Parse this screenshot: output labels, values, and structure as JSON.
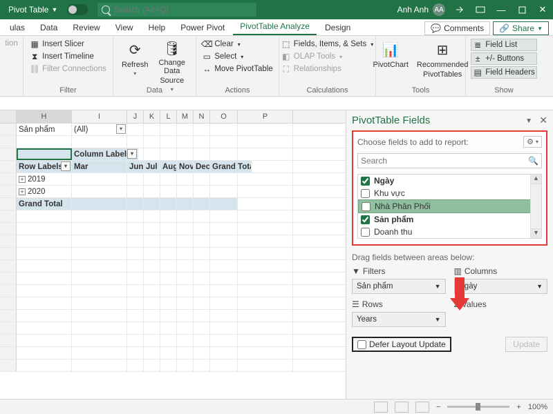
{
  "title": {
    "doc": "Pivot Table",
    "user": "Anh Anh",
    "avatar": "AA",
    "search_placeholder": "Search (Alt+Q)"
  },
  "tabs": {
    "items": [
      "ulas",
      "Data",
      "Review",
      "View",
      "Help",
      "Power Pivot",
      "PivotTable Analyze",
      "Design"
    ],
    "active_index": 6,
    "comments": "Comments",
    "share": "Share"
  },
  "ribbon": {
    "g0": {
      "item": "tion"
    },
    "filter": {
      "label": "Filter",
      "slicer": "Insert Slicer",
      "timeline": "Insert Timeline",
      "connections": "Filter Connections"
    },
    "data": {
      "label": "Data",
      "refresh": "Refresh",
      "change": "Change Data",
      "source": "Source"
    },
    "actions": {
      "label": "Actions",
      "clear": "Clear",
      "select": "Select",
      "move": "Move PivotTable"
    },
    "calc": {
      "label": "Calculations",
      "fields": "Fields, Items, & Sets",
      "olap": "OLAP Tools",
      "rel": "Relationships"
    },
    "tools": {
      "label": "Tools",
      "chart": "PivotChart",
      "rec": "Recommended",
      "rec2": "PivotTables"
    },
    "show": {
      "label": "Show",
      "fieldlist": "Field List",
      "buttons": "+/- Buttons",
      "headers": "Field Headers"
    }
  },
  "grid": {
    "cols": [
      {
        "l": "H",
        "w": 80
      },
      {
        "l": "I",
        "w": 80
      },
      {
        "l": "J",
        "w": 24
      },
      {
        "l": "K",
        "w": 24
      },
      {
        "l": "L",
        "w": 24
      },
      {
        "l": "M",
        "w": 24
      },
      {
        "l": "N",
        "w": 24
      },
      {
        "l": "O",
        "w": 40
      },
      {
        "l": "P",
        "w": 80
      }
    ],
    "rows": {
      "filter_label": "Sản phẩm",
      "filter_val": "(All)",
      "collabels": "Column Labels",
      "rowlabels": "Row Labels",
      "mar": "Mar",
      "jun": "Jun",
      "jul": "Jul",
      "aug": "Aug",
      "nov": "Nov",
      "dec": "Dec",
      "gt": "Grand Total",
      "y1": "2019",
      "y2": "2020",
      "gtrow": "Grand Total"
    }
  },
  "pane": {
    "title": "PivotTable Fields",
    "choose": "Choose fields to add to report:",
    "search_ph": "Search",
    "fields": [
      {
        "label": "Ngày",
        "checked": true,
        "bold": true
      },
      {
        "label": "Khu vực",
        "checked": false
      },
      {
        "label": "Nhà Phân Phối",
        "checked": false,
        "hl": true
      },
      {
        "label": "Sản phẩm",
        "checked": true,
        "bold": true
      },
      {
        "label": "Doanh thu",
        "checked": false
      }
    ],
    "drag": "Drag fields between areas below:",
    "filters_t": "Filters",
    "filters_v": "Sản phẩm",
    "cols_t": "Columns",
    "cols_v": "Ngày",
    "rows_t": "Rows",
    "rows_v": "Years",
    "vals_t": "Values",
    "defer": "Defer Layout Update",
    "update": "Update"
  },
  "status": {
    "zoom": "100%"
  }
}
